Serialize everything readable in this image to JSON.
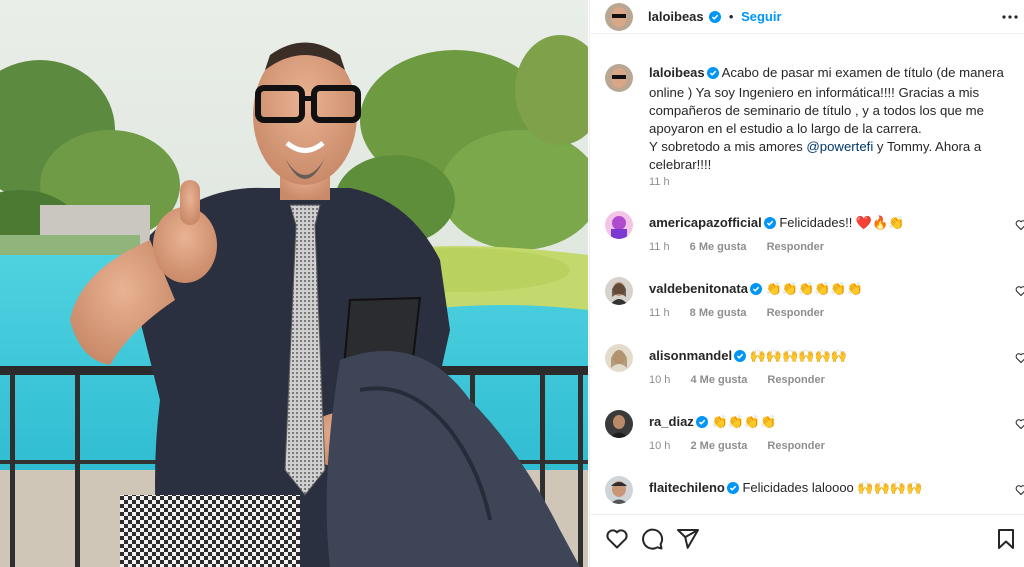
{
  "post": {
    "username": "laloibeas",
    "follow_label": "Seguir",
    "dot": "•",
    "more_icon": "more-horizontal-icon",
    "caption_user": "laloibeas",
    "caption_text_1": "Acabo de pasar mi examen de título (de manera online ) Ya soy Ingeniero en informática!!!! Gracias a mis compañeros de seminario de título , y a todos los que me apoyaron en el estudio a lo largo de la carrera.\nY sobretodo a mis amores ",
    "caption_mention": "@powertefi",
    "caption_text_2": " y Tommy. Ahora a celebrar!!!!",
    "caption_time": "11 h"
  },
  "comments": [
    {
      "user": "americapazofficial",
      "text": "Felicidades!! ❤️🔥👏",
      "time": "11 h",
      "likes": "6 Me gusta",
      "reply": "Responder"
    },
    {
      "user": "valdebenitonata",
      "text": "👏👏👏👏👏👏",
      "time": "11 h",
      "likes": "8 Me gusta",
      "reply": "Responder"
    },
    {
      "user": "alisonmandel",
      "text": "🙌🙌🙌🙌🙌🙌",
      "time": "10 h",
      "likes": "4 Me gusta",
      "reply": "Responder"
    },
    {
      "user": "ra_diaz",
      "text": "👏👏👏👏",
      "time": "10 h",
      "likes": "2 Me gusta",
      "reply": "Responder"
    },
    {
      "user": "flaitechileno",
      "text": "Felicidades laloooo 🙌🙌🙌🙌",
      "time": "",
      "likes": "",
      "reply": ""
    }
  ],
  "colors": {
    "accent": "#0095f6",
    "verified": "#0095f6",
    "mention": "#00376b",
    "muted": "#8e8e8e",
    "like_red": "#ed4956"
  },
  "icons": [
    "heart-icon",
    "comment-icon",
    "share-icon",
    "bookmark-icon",
    "verified-badge-icon"
  ]
}
